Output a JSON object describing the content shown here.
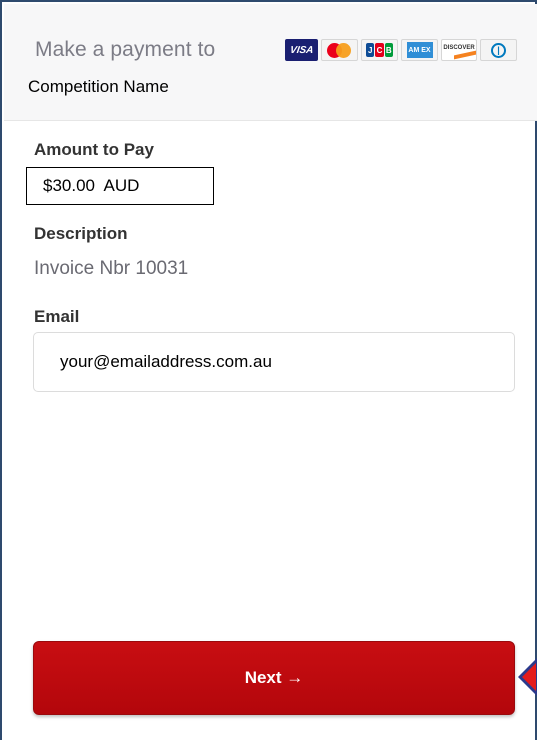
{
  "header": {
    "make_payment_text": "Make a payment to",
    "competition_name": "Competition Name",
    "cards": [
      {
        "name": "VISA",
        "icon": "visa-card-icon"
      },
      {
        "name": "Mastercard",
        "icon": "mastercard-card-icon"
      },
      {
        "name": "JCB",
        "icon": "jcb-card-icon"
      },
      {
        "name": "AMEX",
        "icon": "amex-card-icon"
      },
      {
        "name": "DISCOVER",
        "icon": "discover-card-icon"
      },
      {
        "name": "Diners Club",
        "icon": "diners-card-icon"
      }
    ]
  },
  "amount": {
    "label": "Amount to Pay",
    "value": "$30.00  AUD"
  },
  "description": {
    "label": "Description",
    "value": "Invoice Nbr 10031"
  },
  "email": {
    "label": "Email",
    "value": "your@emailaddress.com.au"
  },
  "next_button": {
    "label": "Next →"
  },
  "colors": {
    "button_red": "#c00a0e",
    "frame_border": "#2e4a6e",
    "indicator_red": "#e41b1b",
    "indicator_blue": "#2b3a8c"
  }
}
